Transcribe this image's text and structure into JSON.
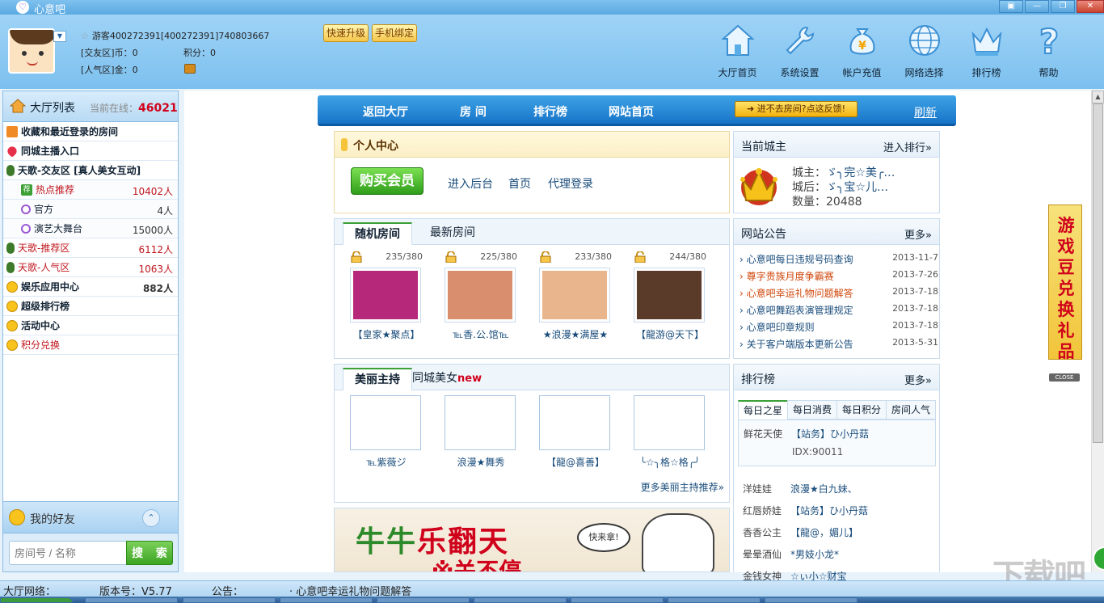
{
  "window": {
    "title": "心意吧",
    "logo_glyph": "♡"
  },
  "header": {
    "user_line": "游客400272391[400272391]740803667",
    "coins_label": "[交友区]币：",
    "coins_value": "0",
    "points_label": "积分：",
    "points_value": "0",
    "popularity_label": "[人气区]金：",
    "popularity_value": "0",
    "quick_upgrade": "快速升级",
    "bind_phone": "手机绑定"
  },
  "topnav": [
    {
      "label": "大厅首页",
      "icon": "home-icon"
    },
    {
      "label": "系统设置",
      "icon": "wrench-icon"
    },
    {
      "label": "帐户充值",
      "icon": "money-bag-icon"
    },
    {
      "label": "网络选择",
      "icon": "globe-icon"
    },
    {
      "label": "排行榜",
      "icon": "crown-icon"
    },
    {
      "label": "帮助",
      "icon": "help-icon"
    }
  ],
  "sidebar": {
    "title": "大厅列表",
    "online_label": "当前在线：",
    "online_count": "46021",
    "rows": [
      {
        "label": "收藏和最近登录的房间",
        "count": "",
        "style": "bold",
        "icon": "house-icon"
      },
      {
        "label": "同城主播入口",
        "count": "",
        "style": "bold",
        "icon": "heart-icon"
      },
      {
        "label": "天歌-交友区   [真人美女互动]",
        "count": "",
        "style": "bold",
        "icon": "mic-icon"
      },
      {
        "label": "热点推荐",
        "count": "10402人",
        "style": "red-sub",
        "icon": "hot-icon"
      },
      {
        "label": "官方",
        "count": "4人",
        "style": "sub",
        "icon": "logo-icon"
      },
      {
        "label": "演艺大舞台",
        "count": "15000人",
        "style": "sub",
        "icon": "logo-icon"
      },
      {
        "label": "天歌-推荐区",
        "count": "6112人",
        "style": "red",
        "icon": "mic-icon"
      },
      {
        "label": "天歌-人气区",
        "count": "1063人",
        "style": "red",
        "icon": "mic-icon"
      },
      {
        "label": "娱乐应用中心",
        "count": "882人",
        "style": "bold",
        "icon": "smile-icon"
      },
      {
        "label": "超级排行榜",
        "count": "",
        "style": "bold",
        "icon": "smile-icon"
      },
      {
        "label": "活动中心",
        "count": "",
        "style": "bold",
        "icon": "smile-icon"
      },
      {
        "label": "积分兑换",
        "count": "",
        "style": "red",
        "icon": "smile-icon"
      }
    ],
    "friends_label": "我的好友",
    "search_placeholder": "房间号 / 名称",
    "search_button": "搜 索"
  },
  "navbar": {
    "back": "返回大厅",
    "rooms": "房 间",
    "rank": "排行榜",
    "site_home": "网站首页",
    "feedback": "进不去房间?点这反馈!",
    "refresh": "刷新"
  },
  "personal": {
    "title": "个人中心",
    "buy": "购买会员",
    "links": [
      "进入后台",
      "首页",
      "代理登录"
    ]
  },
  "rooms_panel": {
    "tabs": [
      "随机房间",
      "最新房间"
    ],
    "rooms": [
      {
        "cap": "235/380",
        "name": "【皇家★聚点】",
        "color": "#b5287a"
      },
      {
        "cap": "225/380",
        "name": "℡香.公.馆℡",
        "color": "#d98e6e"
      },
      {
        "cap": "233/380",
        "name": "★浪漫★满屋★",
        "color": "#e9b58c"
      },
      {
        "cap": "244/380",
        "name": "【龍游@天下】",
        "color": "#5a3a28"
      }
    ]
  },
  "hosts_panel": {
    "tab_active": "美丽主持",
    "tab_other": "同城美女",
    "tab_new": "new",
    "hosts": [
      "℡紫薇ジ",
      "浪漫★舞秀",
      "【龍@喜善】",
      "╰☆╮格☆格╭╯"
    ],
    "more": "更多美丽主持推荐»"
  },
  "banner": {
    "title_a": "牛牛",
    "title_b": "乐翻天",
    "sub": "※关不停",
    "bubble": "快来拿!"
  },
  "city_lord": {
    "title": "当前城主",
    "more": "进入排行»",
    "lord_label": "城主：",
    "lord_value": "ゞ╮完☆美╭…",
    "lady_label": "城后：",
    "lady_value": "ゞ╮宝☆儿…",
    "count_label": "数量：",
    "count_value": "20488"
  },
  "notices": {
    "title": "网站公告",
    "more": "更多»",
    "items": [
      {
        "text": "› 心意吧每日违规号码查询",
        "date": "2013-11-7",
        "orange": false
      },
      {
        "text": "› 尊字贵族月度争霸赛",
        "date": "2013-7-26",
        "orange": true
      },
      {
        "text": "› 心意吧幸运礼物问题解答",
        "date": "2013-7-18",
        "orange": true
      },
      {
        "text": "› 心意吧舞蹈表演管理规定",
        "date": "2013-7-18",
        "orange": false
      },
      {
        "text": "› 心意吧印章规则",
        "date": "2013-7-18",
        "orange": false
      },
      {
        "text": "› 关于客户端版本更新公告",
        "date": "2013-5-31",
        "orange": false
      }
    ]
  },
  "ranking": {
    "title": "排行榜",
    "more": "更多»",
    "tabs": [
      "每日之星",
      "每日消费",
      "每日积分",
      "房间人气"
    ],
    "top_label": "鲜花天使",
    "top_value": "【站务】ひ小丹菇",
    "top_idx": "IDX:90011",
    "rows": [
      {
        "label": "洋娃娃",
        "value": "浪漫★白九妹、"
      },
      {
        "label": "红唇娇娃",
        "value": "【站务】ひ小丹菇"
      },
      {
        "label": "香香公主",
        "value": "【龍@，媚儿】"
      },
      {
        "label": "晕晕酒仙",
        "value": "*男妓小龙*"
      },
      {
        "label": "金钱女神",
        "value": "☆ぃ小☆财宝"
      }
    ]
  },
  "side_ad": {
    "text": "游戏豆兑换礼品",
    "close": "CLOSE"
  },
  "statusbar": {
    "network": "大厅网络：",
    "version": "版本号：V5.77",
    "notice_label": "公告：",
    "notice_text": "·  心意吧幸运礼物问题解答"
  },
  "watermark": "下载吧"
}
